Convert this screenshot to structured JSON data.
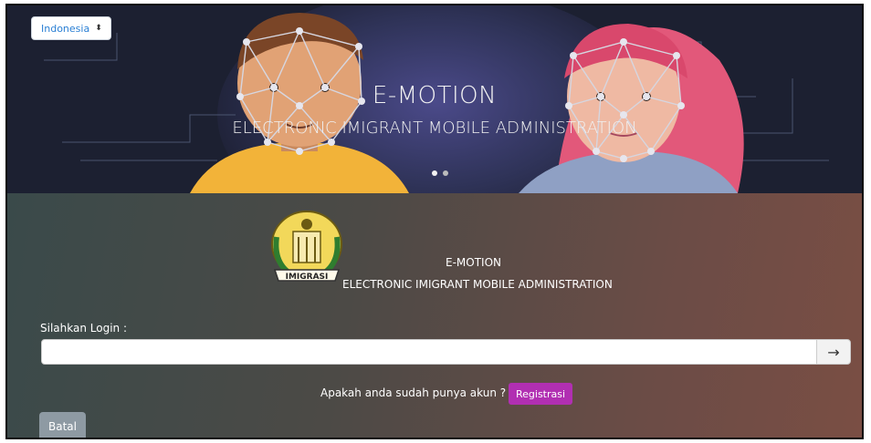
{
  "language_selector": {
    "value": "Indonesia",
    "caret_icon": "sort-caret-icon"
  },
  "hero": {
    "title": "E-MOTION",
    "subtitle": "ELECTRONIC IMIGRANT MOBILE ADMINISTRATION",
    "carousel_slides": 2,
    "active_slide": 1
  },
  "panel": {
    "logo_text": "IMIGRASI",
    "title": "E-MOTION",
    "subtitle": "ELECTRONIC IMIGRANT MOBILE ADMINISTRATION"
  },
  "login": {
    "label": "Silahkan Login :",
    "input_value": "",
    "submit_icon": "arrow-right-icon",
    "submit_glyph": "→"
  },
  "register": {
    "prompt": "Apakah anda sudah punya akun ?",
    "button_label": "Registrasi"
  },
  "cancel": {
    "button_label": "Batal"
  },
  "colors": {
    "register_button": "#b12fb2",
    "cancel_button": "#8e9aa3",
    "language_text": "#2a7fd4"
  }
}
